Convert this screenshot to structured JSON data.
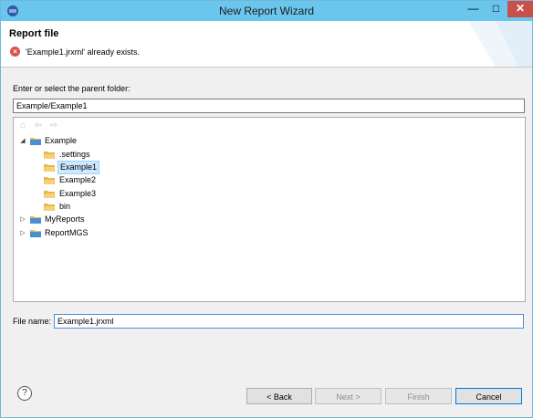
{
  "window": {
    "title": "New Report Wizard"
  },
  "titlebar": {
    "minimize": "—",
    "maximize": "□",
    "close": "✕"
  },
  "header": {
    "title": "Report file",
    "error_glyph": "×",
    "message": "'Example1.jrxml' already exists."
  },
  "folder_field": {
    "label": "Enter or select the parent folder:",
    "value": "Example/Example1"
  },
  "nav": {
    "home": "⌂",
    "back": "⇦",
    "forward": "⇨"
  },
  "tree": {
    "items": [
      {
        "label": "Example",
        "expanded": true,
        "level": 0
      },
      {
        "label": ".settings",
        "level": 1
      },
      {
        "label": "Example1",
        "level": 1,
        "selected": true
      },
      {
        "label": "Example2",
        "level": 1
      },
      {
        "label": "Example3",
        "level": 1
      },
      {
        "label": "bin",
        "level": 1
      },
      {
        "label": "MyReports",
        "expanded": false,
        "level": 0
      },
      {
        "label": "ReportMGS",
        "expanded": false,
        "level": 0
      }
    ],
    "twisty_expanded": "◢",
    "twisty_collapsed": "▷"
  },
  "file_name": {
    "label": "File name:",
    "value": "Example1.jrxml"
  },
  "buttons": {
    "help": "?",
    "back": "< Back",
    "next": "Next >",
    "finish": "Finish",
    "cancel": "Cancel"
  },
  "colors": {
    "titlebar": "#6ac6ec",
    "close": "#c7504a",
    "selection": "#cde8ff",
    "folder": "#e8b84a",
    "project": "#4a8fd4"
  }
}
